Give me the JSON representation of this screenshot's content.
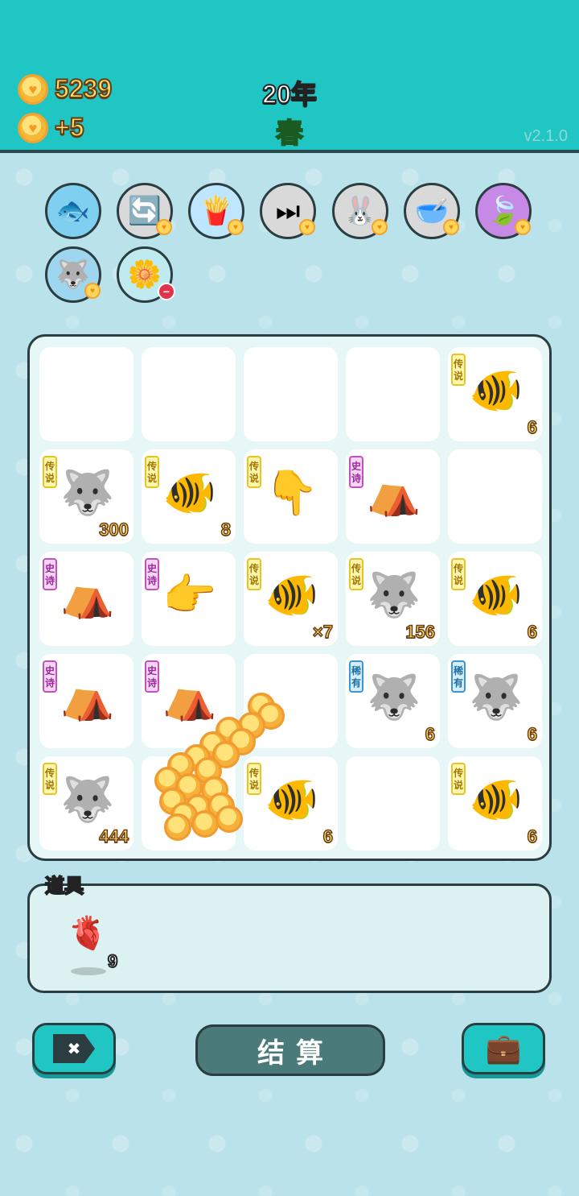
{
  "header": {
    "coins": "5239",
    "income": "+5",
    "year": "20年",
    "season": "春",
    "version": "v2.1.0"
  },
  "buffs": [
    {
      "name": "fishbowl-icon",
      "glyph": "🐟",
      "bg": "#7fd0f0"
    },
    {
      "name": "refresh-icon",
      "glyph": "🔄",
      "bg": "#d9d9d9"
    },
    {
      "name": "fries-icon",
      "glyph": "🍟",
      "bg": "#bfe6ff"
    },
    {
      "name": "skip-icon",
      "glyph": "⏭",
      "bg": "#d9d9d9"
    },
    {
      "name": "rabbit-icon",
      "glyph": "🐰",
      "bg": "#d9d9d9"
    },
    {
      "name": "pet-food-bowl-icon",
      "glyph": "🥣",
      "bg": "#d9d9d9"
    },
    {
      "name": "leaf-icon",
      "glyph": "🍃",
      "bg": "#c68ae6"
    },
    {
      "name": "husky-icon",
      "glyph": "🐺",
      "bg": "#9ed6f0"
    },
    {
      "name": "flower-pot-icon",
      "glyph": "🌼",
      "bg": "#bfeaf0"
    }
  ],
  "board": {
    "cells": [
      {
        "tag": "",
        "tagType": "",
        "icon": "",
        "glyph": "",
        "count": ""
      },
      {
        "tag": "",
        "tagType": "",
        "icon": "",
        "glyph": "",
        "count": ""
      },
      {
        "tag": "",
        "tagType": "",
        "icon": "",
        "glyph": "",
        "count": ""
      },
      {
        "tag": "",
        "tagType": "",
        "icon": "",
        "glyph": "",
        "count": ""
      },
      {
        "tag": "传说",
        "tagType": "legend",
        "icon": "koi-fish-icon",
        "glyph": "🐠",
        "count": "6"
      },
      {
        "tag": "传说",
        "tagType": "legend",
        "icon": "king-husky-icon",
        "glyph": "🐺",
        "count": "300"
      },
      {
        "tag": "传说",
        "tagType": "legend",
        "icon": "koi-fish-icon",
        "glyph": "🐠",
        "count": "8"
      },
      {
        "tag": "传说",
        "tagType": "legend",
        "icon": "pointing-hand-icon",
        "glyph": "👇",
        "count": ""
      },
      {
        "tag": "史诗",
        "tagType": "epic",
        "icon": "rabbit-tent-icon",
        "glyph": "⛺",
        "count": ""
      },
      {
        "tag": "",
        "tagType": "",
        "icon": "",
        "glyph": "",
        "count": ""
      },
      {
        "tag": "史诗",
        "tagType": "epic",
        "icon": "rabbit-tent-icon",
        "glyph": "⛺",
        "count": ""
      },
      {
        "tag": "史诗",
        "tagType": "epic",
        "icon": "pointing-hand-icon",
        "glyph": "👉",
        "count": ""
      },
      {
        "tag": "传说",
        "tagType": "legend",
        "icon": "koi-fish-icon",
        "glyph": "🐠",
        "count": "×7"
      },
      {
        "tag": "传说",
        "tagType": "legend",
        "icon": "king-husky-icon",
        "glyph": "🐺",
        "count": "156"
      },
      {
        "tag": "传说",
        "tagType": "legend",
        "icon": "koi-fish-icon",
        "glyph": "🐠",
        "count": "6"
      },
      {
        "tag": "史诗",
        "tagType": "epic",
        "icon": "rabbit-tent-icon",
        "glyph": "⛺",
        "count": ""
      },
      {
        "tag": "史诗",
        "tagType": "epic",
        "icon": "rabbit-tent-icon",
        "glyph": "⛺",
        "count": ""
      },
      {
        "tag": "",
        "tagType": "",
        "icon": "",
        "glyph": "",
        "count": ""
      },
      {
        "tag": "稀有",
        "tagType": "rare",
        "icon": "husky-icon",
        "glyph": "🐺",
        "count": "6"
      },
      {
        "tag": "稀有",
        "tagType": "rare",
        "icon": "husky-icon",
        "glyph": "🐺",
        "count": "6"
      },
      {
        "tag": "传说",
        "tagType": "legend",
        "icon": "king-husky-icon",
        "glyph": "🐺",
        "count": "444"
      },
      {
        "tag": "",
        "tagType": "",
        "icon": "",
        "glyph": "",
        "count": ""
      },
      {
        "tag": "传说",
        "tagType": "legend",
        "icon": "koi-fish-icon",
        "glyph": "🐠",
        "count": "6"
      },
      {
        "tag": "",
        "tagType": "",
        "icon": "",
        "glyph": "",
        "count": ""
      },
      {
        "tag": "传说",
        "tagType": "legend",
        "icon": "koi-fish-icon",
        "glyph": "🐠",
        "count": "6"
      }
    ]
  },
  "tools": {
    "title": "道具",
    "item_icon": "liver-icon",
    "item_glyph": "🫀",
    "item_count": "9"
  },
  "buttons": {
    "close_glyph": "✖",
    "settle_label": "结算",
    "bag_glyph": "💼"
  },
  "colors": {
    "header_bg": "#1fc6c4",
    "page_bg": "#b9e2ea",
    "coin_text": "#ffe06a",
    "season_text": "#38e046",
    "settle_button": "#4a7a7a"
  }
}
